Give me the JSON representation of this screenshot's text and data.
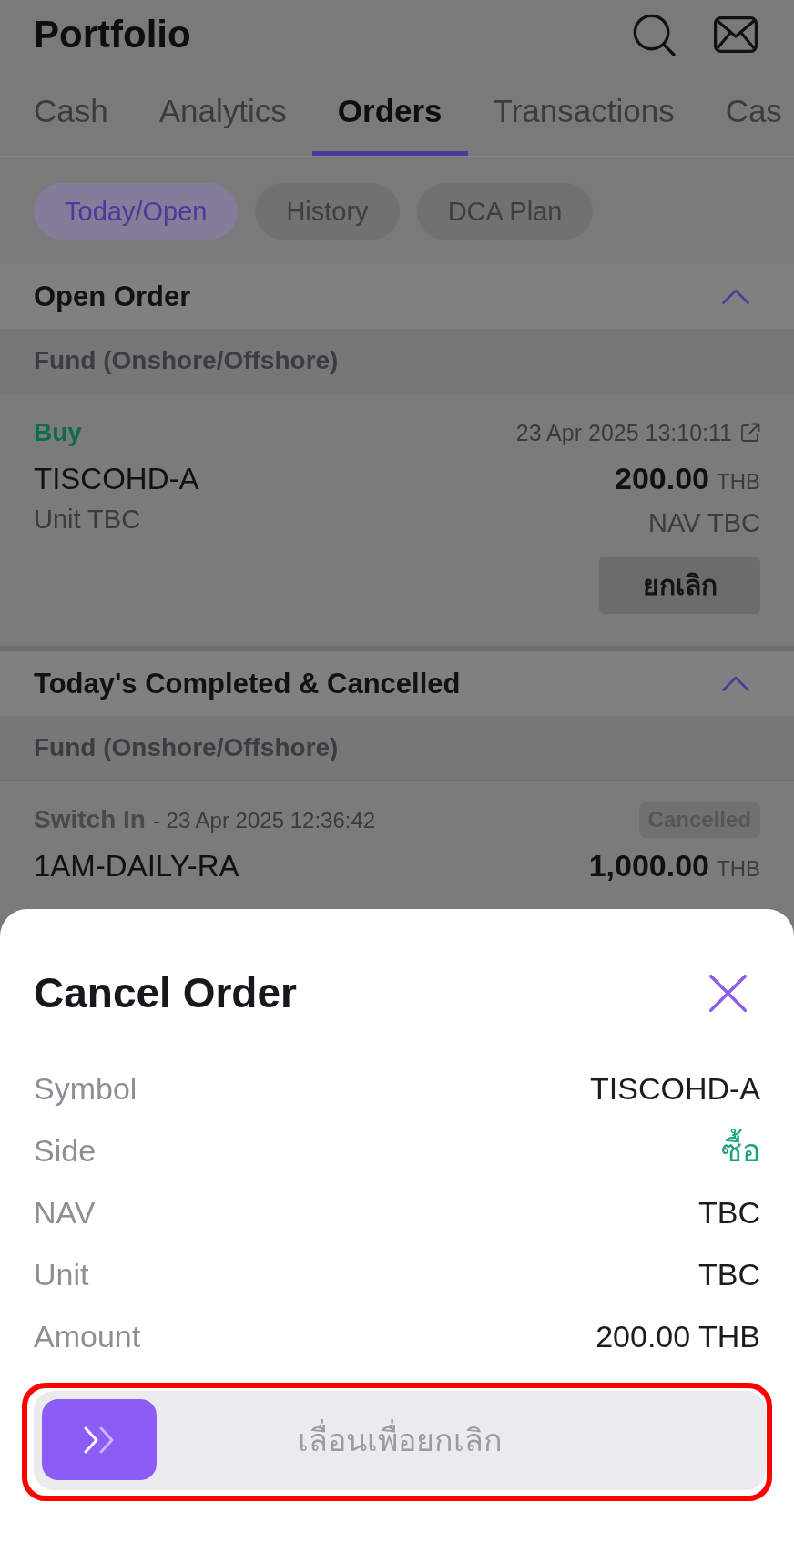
{
  "header": {
    "title": "Portfolio"
  },
  "tabs": [
    {
      "label": "Cash",
      "selected": false
    },
    {
      "label": "Analytics",
      "selected": false
    },
    {
      "label": "Orders",
      "selected": true
    },
    {
      "label": "Transactions",
      "selected": false
    },
    {
      "label": "Cas",
      "selected": false
    }
  ],
  "filters": [
    {
      "label": "Today/Open",
      "selected": true
    },
    {
      "label": "History",
      "selected": false
    },
    {
      "label": "DCA Plan",
      "selected": false
    }
  ],
  "sections": [
    {
      "title": "Open Order",
      "expanded": true,
      "groups": [
        {
          "title": "Fund (Onshore/Offshore)",
          "orders": [
            {
              "kind": "open",
              "side": "Buy",
              "color": "#0f6b50",
              "time": "23 Apr 2025 13:10:11",
              "symbol": "TISCOHD-A",
              "amount": "200.00",
              "currency": "THB",
              "unit": "Unit TBC",
              "nav": "NAV TBC",
              "cancel_button": "ยกเลิก"
            }
          ]
        }
      ]
    },
    {
      "title": "Today's Completed & Cancelled",
      "expanded": true,
      "groups": [
        {
          "title": "Fund (Onshore/Offshore)",
          "orders": [
            {
              "kind": "closed",
              "side": "Switch In",
              "color": "#4a4a4a",
              "time": "- 23 Apr 2025 12:36:42",
              "status": "Cancelled",
              "symbol": "1AM-DAILY-RA",
              "amount": "1,000.00",
              "currency": "THB"
            }
          ]
        }
      ]
    }
  ],
  "cancel_sheet": {
    "title": "Cancel Order",
    "details": [
      {
        "label": "Symbol",
        "value": "TISCOHD-A"
      },
      {
        "label": "Side",
        "value": "ซื้อ",
        "color": "#1aa37a"
      },
      {
        "label": "NAV",
        "value": "TBC"
      },
      {
        "label": "Unit",
        "value": "TBC"
      },
      {
        "label": "Amount",
        "value": "200.00 THB"
      }
    ],
    "slider": {
      "label": "เลื่อนเพื่อยกเลิก",
      "level": 0
    }
  }
}
